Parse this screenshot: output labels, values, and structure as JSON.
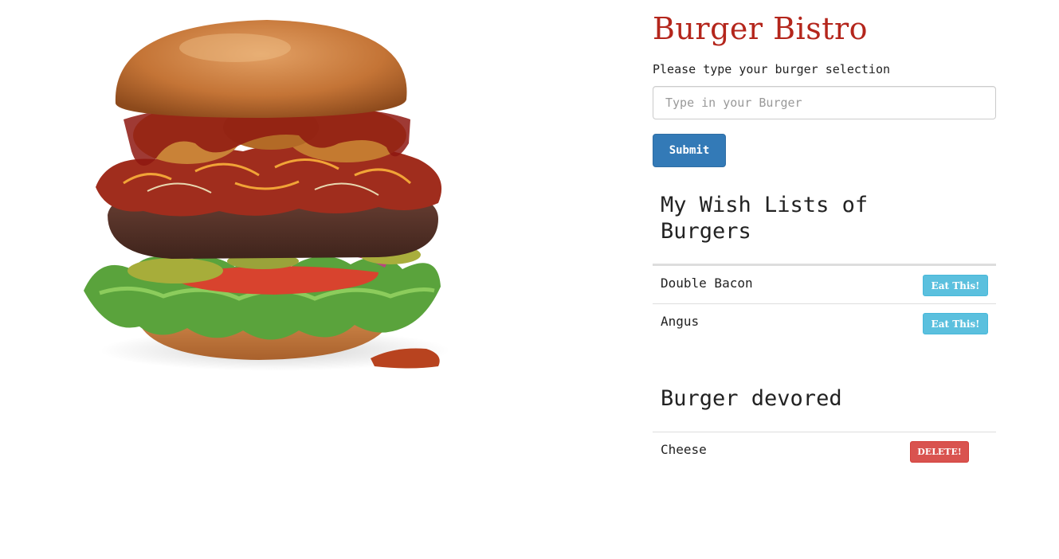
{
  "app": {
    "title": "Burger Bistro"
  },
  "form": {
    "prompt": "Please type your burger selection",
    "input_placeholder": "Type in your Burger",
    "input_value": "",
    "submit_label": "Submit"
  },
  "wishlist": {
    "title": "My Wish Lists of Burgers",
    "items": [
      {
        "name": "Double Bacon",
        "action": "Eat This!"
      },
      {
        "name": "Angus",
        "action": "Eat This!"
      }
    ]
  },
  "devoured": {
    "title": "Burger devored",
    "items": [
      {
        "name": "Cheese",
        "action": "DELETE!"
      }
    ]
  },
  "colors": {
    "brand_red": "#b4261c",
    "primary": "#337ab7",
    "info": "#5bc0de",
    "danger": "#d9534f"
  },
  "hero": {
    "icon": "burger-image"
  }
}
